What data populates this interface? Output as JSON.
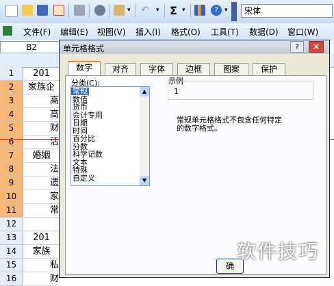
{
  "toolbar": {
    "font_name": "宋体",
    "icons": [
      "new-icon",
      "open-icon",
      "save-icon",
      "permission-icon",
      "print-icon",
      "research-icon",
      "paste-icon",
      "undo-icon",
      "sum-icon",
      "chart-icon",
      "help-icon"
    ],
    "sum_glyph": "Σ"
  },
  "menubar": {
    "items": [
      "文件(F)",
      "编辑(E)",
      "视图(V)",
      "插入(I)",
      "格式(O)",
      "工具(T)",
      "数据(D)",
      "窗口(W)"
    ]
  },
  "namebox": {
    "value": "B2"
  },
  "sheet": {
    "rows": [
      {
        "num": "1",
        "text": "201",
        "selected": false
      },
      {
        "num": "2",
        "text": "家族企",
        "selected": true
      },
      {
        "num": "3",
        "text": "高",
        "selected": true
      },
      {
        "num": "4",
        "text": "高",
        "selected": true
      },
      {
        "num": "5",
        "text": "财",
        "selected": true
      },
      {
        "num": "6",
        "text": "活",
        "selected": true
      },
      {
        "num": "7",
        "text": "婚姻",
        "selected": true
      },
      {
        "num": "8",
        "text": "法",
        "selected": true
      },
      {
        "num": "9",
        "text": "遗",
        "selected": true
      },
      {
        "num": "10",
        "text": "家",
        "selected": true
      },
      {
        "num": "11",
        "text": "常",
        "selected": true
      },
      {
        "num": "12",
        "text": "",
        "selected": false
      },
      {
        "num": "13",
        "text": "201",
        "selected": false
      },
      {
        "num": "14",
        "text": "家族",
        "selected": false
      },
      {
        "num": "15",
        "text": "私",
        "selected": false
      },
      {
        "num": "16",
        "text": "财",
        "selected": false
      }
    ]
  },
  "dialog": {
    "title": "单元格格式",
    "help_label": "?",
    "close_label": "×",
    "tabs": [
      "数字",
      "对齐",
      "字体",
      "边框",
      "图案",
      "保护"
    ],
    "active_tab": "数字",
    "category_label": "分类(C):",
    "categories": [
      "常规",
      "数值",
      "货币",
      "会计专用",
      "日期",
      "时间",
      "百分比",
      "分数",
      "科学记数",
      "文本",
      "特殊",
      "自定义"
    ],
    "selected_category": "常规",
    "sample_label": "示例",
    "sample_value": "1",
    "description_line1": "常规单元格格式不包含任何特定",
    "description_line2": "的数字格式。",
    "ok_label": "确"
  },
  "watermark": {
    "text": "软件技巧"
  },
  "colors": {
    "selection": "#316ac5",
    "row_header_selected": "#f9b776",
    "red_line": "#d01818"
  }
}
